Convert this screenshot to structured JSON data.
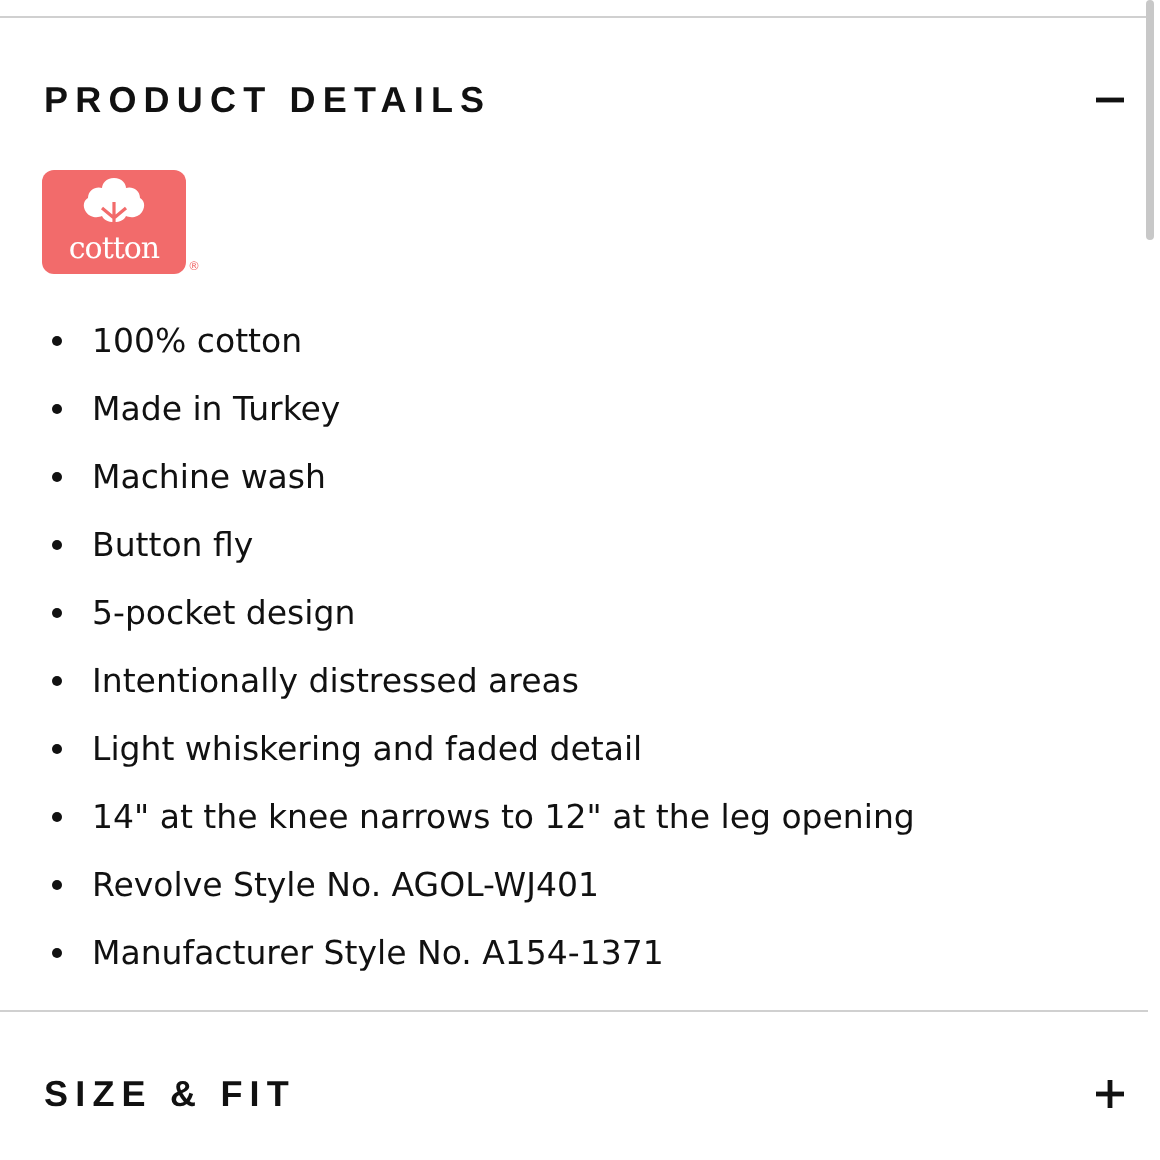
{
  "sections": [
    {
      "title": "PRODUCT DETAILS",
      "expanded": true,
      "logo": {
        "text": "cotton",
        "mark": "®"
      },
      "items": [
        "100% cotton",
        "Made in Turkey",
        "Machine wash",
        "Button fly",
        "5-pocket design",
        "Intentionally distressed areas",
        "Light whiskering and faded detail",
        "14\" at the knee narrows to 12\" at the leg opening",
        "Revolve Style No. AGOL-WJ401",
        "Manufacturer Style No. A154-1371"
      ]
    },
    {
      "title": "SIZE & FIT",
      "expanded": false
    }
  ]
}
